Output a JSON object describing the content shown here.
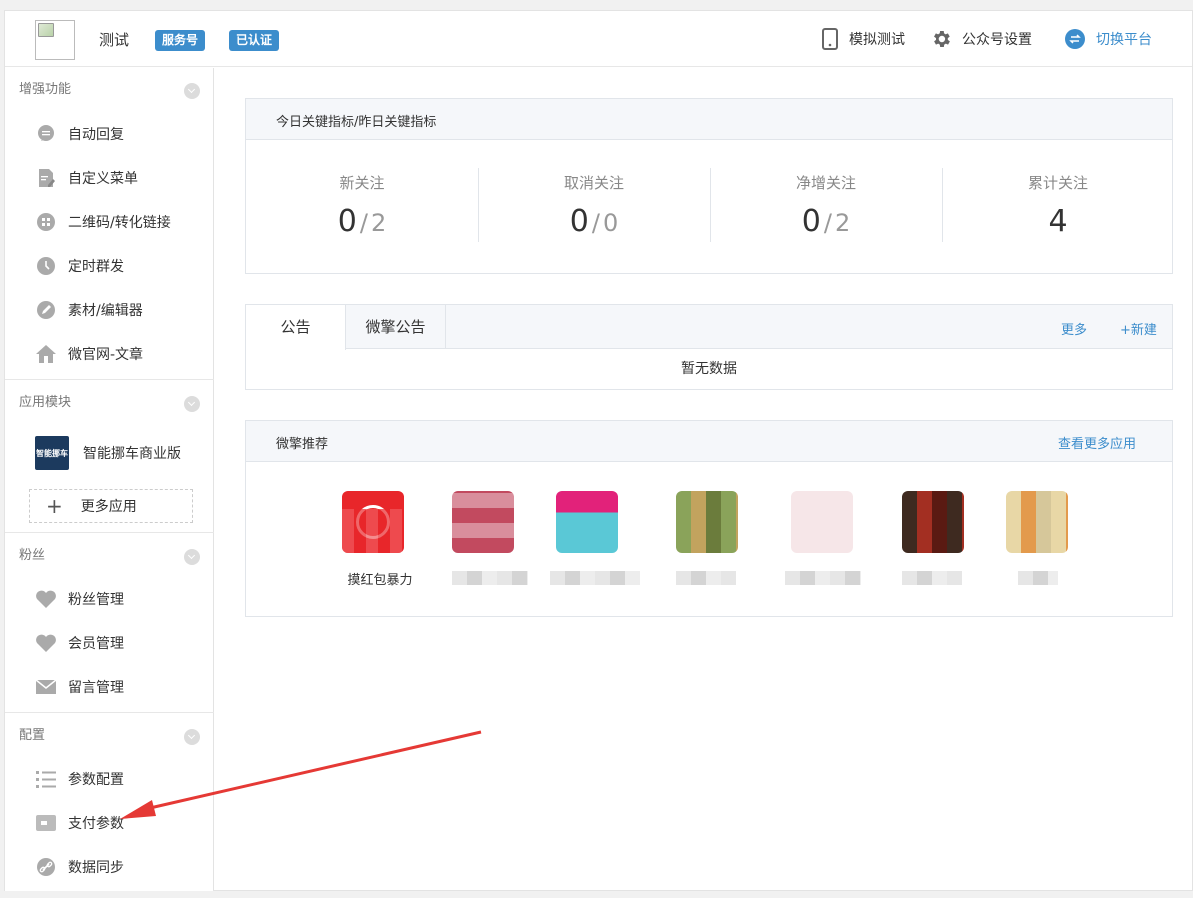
{
  "header": {
    "account_name": "测试",
    "badge_type": "服务号",
    "badge_verified": "已认证",
    "simulate_test": "模拟测试",
    "account_settings": "公众号设置",
    "switch_platform": "切换平台"
  },
  "sidebar": {
    "sections": [
      {
        "title": "增强功能",
        "items": [
          "自动回复",
          "自定义菜单",
          "二维码/转化链接",
          "定时群发",
          "素材/编辑器",
          "微官网-文章"
        ]
      },
      {
        "title": "应用模块",
        "app_name": "智能挪车商业版",
        "app_thumb_text": "智能挪车",
        "more_apps": "更多应用"
      },
      {
        "title": "粉丝",
        "items": [
          "粉丝管理",
          "会员管理",
          "留言管理"
        ]
      },
      {
        "title": "配置",
        "items": [
          "参数配置",
          "支付参数",
          "数据同步"
        ]
      }
    ]
  },
  "metrics": {
    "title": "今日关键指标/昨日关键指标",
    "stats": [
      {
        "label": "新关注",
        "today": "0",
        "yesterday": "2"
      },
      {
        "label": "取消关注",
        "today": "0",
        "yesterday": "0"
      },
      {
        "label": "净增关注",
        "today": "0",
        "yesterday": "2"
      },
      {
        "label": "累计关注",
        "total": "4"
      }
    ]
  },
  "notice": {
    "tabs": [
      "公告",
      "微擎公告"
    ],
    "more": "更多",
    "new": "+新建",
    "empty": "暂无数据"
  },
  "recommend": {
    "title": "微擎推荐",
    "view_more": "查看更多应用",
    "first_app_name": "摸红包暴力"
  },
  "colors": {
    "accent": "#3c8dcc",
    "arrow": "#e53935"
  }
}
